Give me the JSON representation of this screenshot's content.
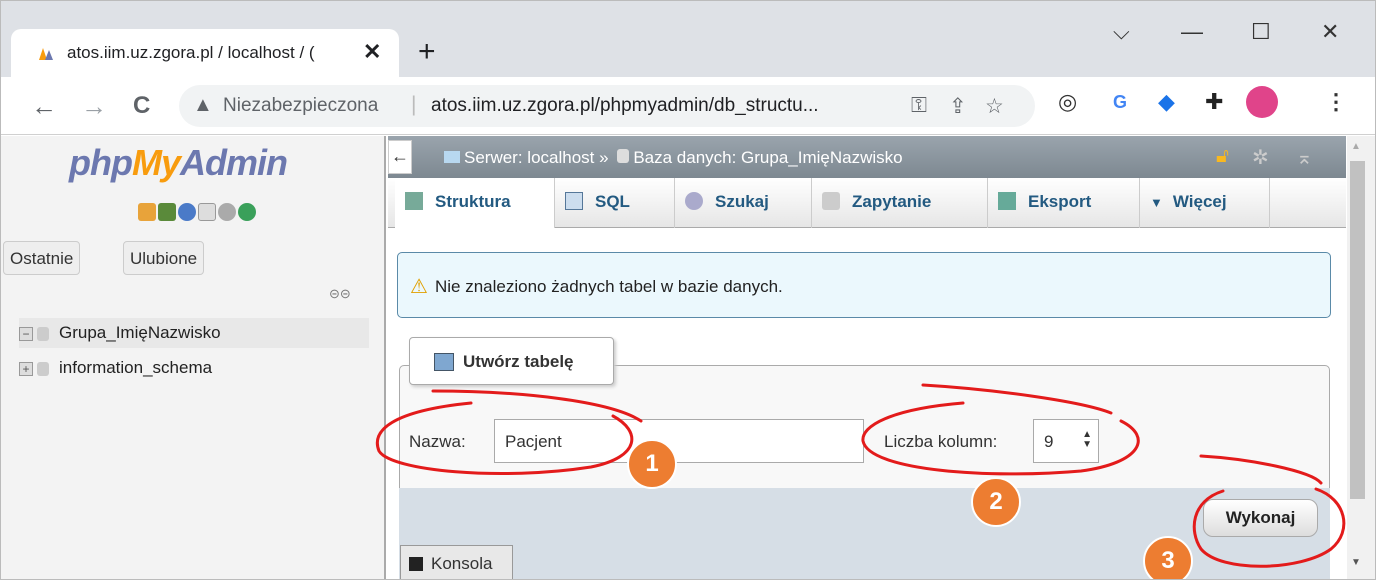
{
  "browser": {
    "tab_title": "atos.iim.uz.zgora.pl / localhost / (",
    "tab_close": "✕",
    "new_tab": "+",
    "window_controls": {
      "minimize": "—",
      "maximize": "☐",
      "close": "✕",
      "dropdown": "⌵"
    },
    "nav": {
      "back": "←",
      "forward": "→",
      "reload": "C"
    },
    "security_label": "Niezabezpieczona",
    "url_separator": "|",
    "url": "atos.iim.uz.zgora.pl/phpmyadmin/db_structu...",
    "icons": [
      "key-icon",
      "share-icon",
      "star-icon",
      "reader-icon",
      "translate-icon",
      "extension-icon",
      "puzzle-icon",
      "profile-icon",
      "menu-icon"
    ]
  },
  "sidebar": {
    "logo_php": "php",
    "logo_my": "My",
    "logo_admin": "Admin",
    "buttons": [
      "Ostatnie",
      "Ulubione"
    ],
    "databases": [
      {
        "name": "Grupa_ImięNazwisko",
        "expanded": true
      },
      {
        "name": "information_schema",
        "expanded": false
      }
    ],
    "expand_open": "−",
    "expand_closed": "+"
  },
  "topbar": {
    "toggle": "←",
    "breadcrumb_server": "Serwer: localhost »",
    "breadcrumb_db": "Baza danych: Grupa_ImięNazwisko"
  },
  "tabs": [
    {
      "label": "Struktura",
      "active": true
    },
    {
      "label": "SQL",
      "active": false
    },
    {
      "label": "Szukaj",
      "active": false
    },
    {
      "label": "Zapytanie",
      "active": false
    },
    {
      "label": "Eksport",
      "active": false
    },
    {
      "label": "Więcej",
      "active": false
    }
  ],
  "notice": "Nie znaleziono żadnych tabel w bazie danych.",
  "create_table": {
    "legend": "Utwórz tabelę",
    "name_label": "Nazwa:",
    "name_value": "Pacjent",
    "columns_label": "Liczba kolumn:",
    "columns_value": "9",
    "submit": "Wykonaj"
  },
  "console_label": "Konsola",
  "callouts": [
    "1",
    "2",
    "3"
  ],
  "colors": {
    "annotation_red": "#e31b1b",
    "callout_orange": "#ed7d31",
    "link_blue": "#235a81"
  }
}
